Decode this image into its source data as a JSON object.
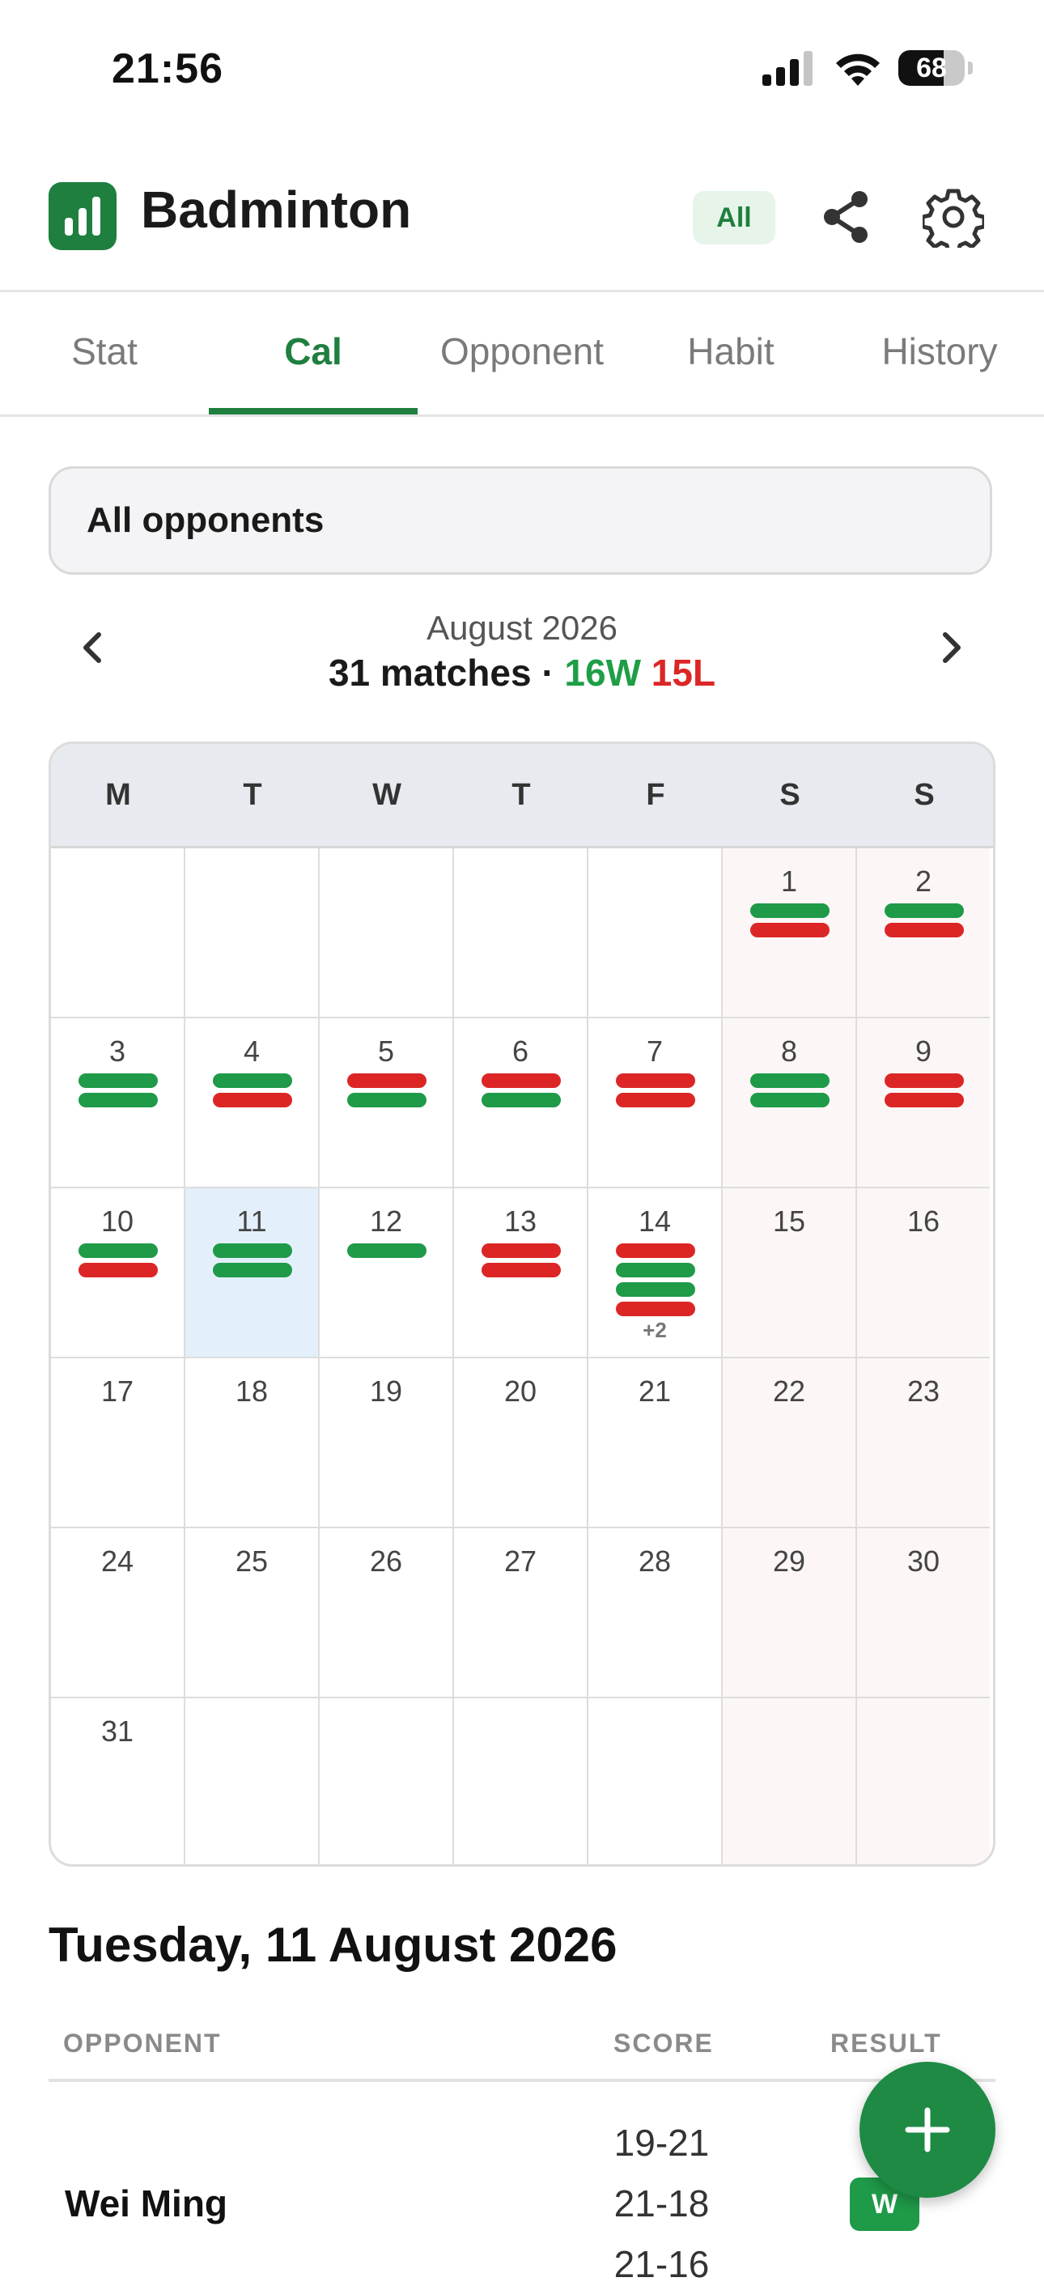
{
  "status_bar": {
    "time": "21:56",
    "battery": "68",
    "battery_level": 0.68
  },
  "header": {
    "app_icon": "bar-chart-icon",
    "title": "Badminton",
    "filter_badge": "All",
    "share_icon": "share-icon",
    "settings_icon": "gear-icon"
  },
  "tabs": [
    {
      "label": "Stat",
      "active": false
    },
    {
      "label": "Cal",
      "active": true
    },
    {
      "label": "Opponent",
      "active": false
    },
    {
      "label": "Habit",
      "active": false
    },
    {
      "label": "History",
      "active": false
    }
  ],
  "opponent_filter": {
    "value": "All opponents"
  },
  "month_nav": {
    "month": "August 2026",
    "matches": "31 matches · ",
    "wins": "16W",
    "losses": "15L",
    "prev_icon": "chevron-left-icon",
    "next_icon": "chevron-right-icon"
  },
  "calendar": {
    "weekdays": [
      "M",
      "T",
      "W",
      "T",
      "F",
      "S",
      "S"
    ],
    "first_weekday_index": 5,
    "days_in_month": 31,
    "selected_day": 11,
    "weekend_color": "#fcf7f6",
    "win_color": "#1f9a48",
    "loss_color": "#dc2626",
    "results": {
      "1": [
        "W",
        "L"
      ],
      "2": [
        "W",
        "L"
      ],
      "3": [
        "W",
        "W"
      ],
      "4": [
        "W",
        "L"
      ],
      "5": [
        "L",
        "W"
      ],
      "6": [
        "L",
        "W"
      ],
      "7": [
        "L",
        "L"
      ],
      "8": [
        "W",
        "W"
      ],
      "9": [
        "L",
        "L"
      ],
      "10": [
        "W",
        "L"
      ],
      "11": [
        "W",
        "W"
      ],
      "12": [
        "W"
      ],
      "13": [
        "L",
        "L"
      ],
      "14": [
        "L",
        "W",
        "W",
        "L"
      ]
    },
    "more": {
      "14": "+2"
    }
  },
  "selected_day": {
    "title": "Tuesday, 11 August 2026",
    "columns": {
      "opponent": "OPPONENT",
      "score": "SCORE",
      "result": "RESULT"
    },
    "matches": [
      {
        "opponent": "Wei Ming",
        "games": [
          "19-21",
          "21-18",
          "21-16"
        ],
        "result": "W"
      }
    ]
  },
  "fab": {
    "icon": "plus-icon"
  },
  "colors": {
    "accent": "#1e7f3e",
    "win": "#1f9a48",
    "loss": "#dc2626",
    "selected": "#e3f0fb"
  }
}
